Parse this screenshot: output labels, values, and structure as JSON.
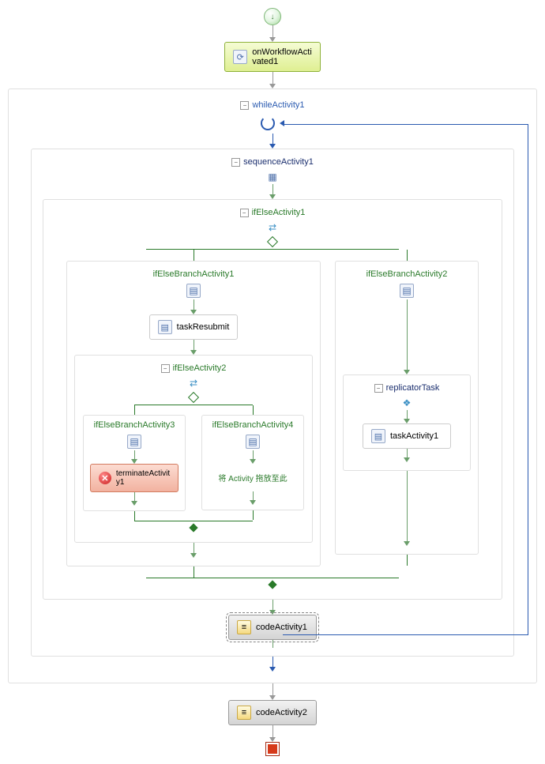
{
  "start": {
    "glyph": "↓"
  },
  "end": {},
  "activities": {
    "onWorkflowActivated1": "onWorkflowActi\nvated1",
    "taskResubmit": "taskResubmit",
    "terminateActivity1": "terminateActivit\ny1",
    "taskActivity1": "taskActivity1",
    "codeActivity1": "codeActivity1",
    "codeActivity2": "codeActivity2"
  },
  "containers": {
    "whileActivity1": "whileActivity1",
    "sequenceActivity1": "sequenceActivity1",
    "ifElseActivity1": "ifElseActivity1",
    "ifElseBranchActivity1": "ifElseBranchActivity1",
    "ifElseBranchActivity2": "ifElseBranchActivity2",
    "ifElseActivity2": "ifElseActivity2",
    "ifElseBranchActivity3": "ifElseBranchActivity3",
    "ifElseBranchActivity4": "ifElseBranchActivity4",
    "replicatorTask": "replicatorTask"
  },
  "dropHint": "将 Activity 拖放至此",
  "collapse": "−"
}
